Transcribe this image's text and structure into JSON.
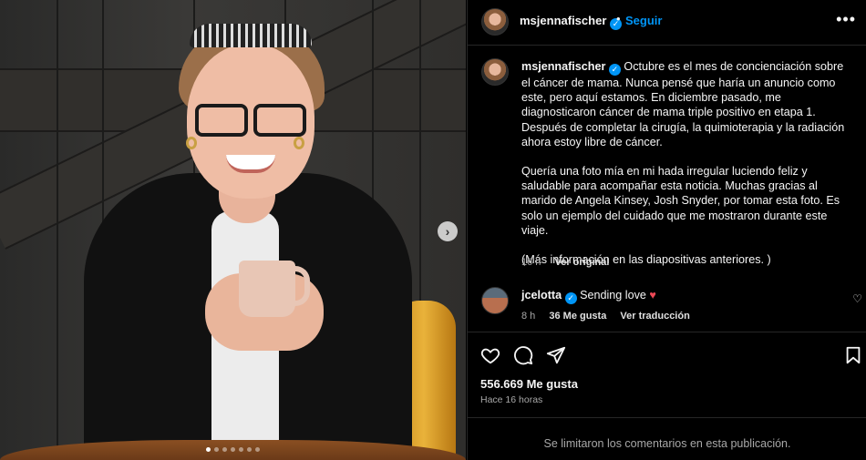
{
  "post": {
    "username": "msjennafischer",
    "separator": "•",
    "follow_label": "Seguir",
    "more_label": "•••",
    "verified_mark": "✓",
    "next_image_label": "›",
    "carousel": {
      "count": 7,
      "active_index": 0
    }
  },
  "caption": {
    "username": "msjennafischer",
    "paragraph_1": "Octubre es el mes de concienciación sobre el cáncer de mama. Nunca pensé que haría un anuncio como este, pero aquí estamos. En diciembre pasado, me diagnosticaron cáncer de mama triple positivo en etapa 1. Después de completar la cirugía, la quimioterapia y la radiación ahora estoy libre de cáncer.",
    "paragraph_2": "Quería una foto mía en mi hada irregular luciendo feliz y saludable para acompañar esta noticia. Muchas gracias al marido de Angela Kinsey, Josh Snyder, por tomar esta foto. Es solo un ejemplo del cuidado que me mostraron durante este viaje.",
    "paragraph_3": "(Más información en las diapositivas anteriores. )",
    "time": "16 h",
    "see_original": "Ver original"
  },
  "comment": {
    "username": "jcelotta",
    "text": "Sending love",
    "emoji": "♥",
    "time": "8 h",
    "likes": "36 Me gusta",
    "see_translation": "Ver traducción",
    "like_icon": "♡"
  },
  "footer": {
    "likes": "556.669 Me gusta",
    "time": "Hace 16 horas",
    "comments_limited": "Se limitaron los comentarios en esta publicación."
  },
  "icons": {
    "like": "heart-outline-icon",
    "comment": "comment-icon",
    "share": "paper-plane-icon",
    "save": "bookmark-icon"
  },
  "colors": {
    "accent": "#0095f6",
    "background": "#000000",
    "secondary_text": "#a8a8a8",
    "heart": "#ed4956"
  }
}
